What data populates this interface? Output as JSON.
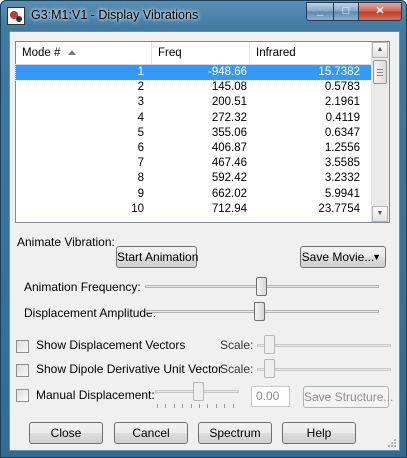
{
  "window": {
    "title": "G3:M1:V1 - Display Vibrations",
    "caption": {
      "minimize": "_",
      "maximize": "□",
      "close": "✕"
    }
  },
  "table": {
    "columns": [
      "Mode #",
      "Freq",
      "Infrared"
    ],
    "rows": [
      {
        "mode": "1",
        "freq": "-948.66",
        "ir": "15.7382"
      },
      {
        "mode": "2",
        "freq": "145.08",
        "ir": "0.5783"
      },
      {
        "mode": "3",
        "freq": "200.51",
        "ir": "2.1961"
      },
      {
        "mode": "4",
        "freq": "272.32",
        "ir": "0.4119"
      },
      {
        "mode": "5",
        "freq": "355.06",
        "ir": "0.6347"
      },
      {
        "mode": "6",
        "freq": "406.87",
        "ir": "1.2556"
      },
      {
        "mode": "7",
        "freq": "467.46",
        "ir": "3.5585"
      },
      {
        "mode": "8",
        "freq": "592.42",
        "ir": "3.2332"
      },
      {
        "mode": "9",
        "freq": "662.02",
        "ir": "5.9941"
      },
      {
        "mode": "10",
        "freq": "712.94",
        "ir": "23.7754"
      }
    ]
  },
  "animate": {
    "label": "Animate Vibration:",
    "start_button": "Start Animation",
    "save_movie_button": "Save Movie...",
    "frequency_label": "Animation Frequency:",
    "amplitude_label": "Displacement Amplitude:"
  },
  "options": {
    "show_displacement_vectors": "Show Displacement Vectors",
    "show_dipole": "Show Dipole Derivative Unit Vector",
    "scale_label": "Scale:",
    "manual_displacement": "Manual Displacement:",
    "manual_value": "0.00",
    "save_structure_button": "Save Structure..."
  },
  "footer": {
    "close": "Close",
    "cancel": "Cancel",
    "spectrum": "Spectrum",
    "help": "Help"
  }
}
